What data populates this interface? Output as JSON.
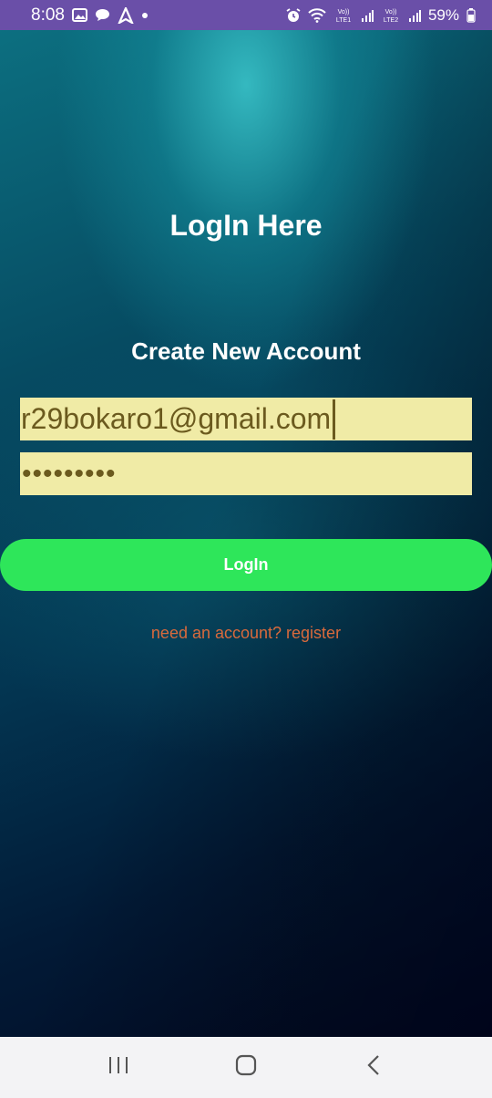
{
  "status_bar": {
    "time": "8:08",
    "left_icons": [
      "gallery-icon",
      "chat-icon",
      "navigation-icon",
      "dot-icon"
    ],
    "right_icons": [
      "alarm-icon",
      "wifi-icon",
      "volte-lte1-icon",
      "signal-icon",
      "volte-lte2-icon",
      "signal-icon",
      "battery-icon"
    ],
    "volte1_label": "Vo)) LTE1",
    "volte2_label": "Vo)) LTE2",
    "battery": "59%"
  },
  "login": {
    "title": "LogIn Here",
    "subtitle": "Create New Account",
    "email_value": "r29bokaro1@gmail.com",
    "password_mask": "•••••••••",
    "button_label": "LogIn",
    "register_link": "need an account? register"
  },
  "colors": {
    "status_bar": "#6a4fa8",
    "field_bg": "#f0eba6",
    "field_text": "#6b5a1e",
    "button": "#2ee65a",
    "link": "#d96a3c"
  },
  "nav_bar": {
    "icons": [
      "recent-apps-icon",
      "home-icon",
      "back-icon"
    ]
  }
}
